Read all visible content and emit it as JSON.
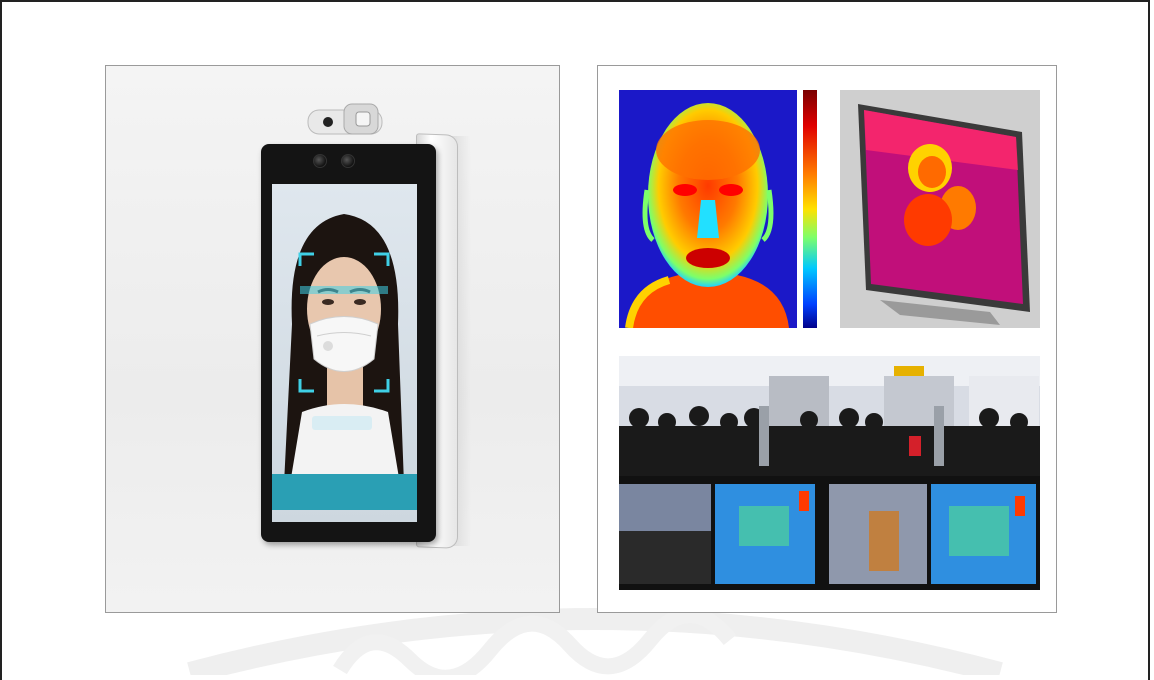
{
  "page": {
    "background": "#ffffff"
  },
  "left_panel": {
    "kiosk_screen": {
      "banner_line1": "",
      "banner_line2": "",
      "banner_color": "#2a9fb4",
      "face_box_color": "#3fd0e6"
    },
    "icons": [
      "camera-icon"
    ]
  },
  "right_panel": {
    "thermal_face_image": {},
    "colorbar": {
      "label": "",
      "colors": [
        "#7a0000",
        "#e00000",
        "#ff7a00",
        "#ffe100",
        "#7dff6a",
        "#00c8ff",
        "#0040ff",
        "#00008a"
      ]
    },
    "thermal_tablet_image": {},
    "crowd_screening_image": {}
  }
}
